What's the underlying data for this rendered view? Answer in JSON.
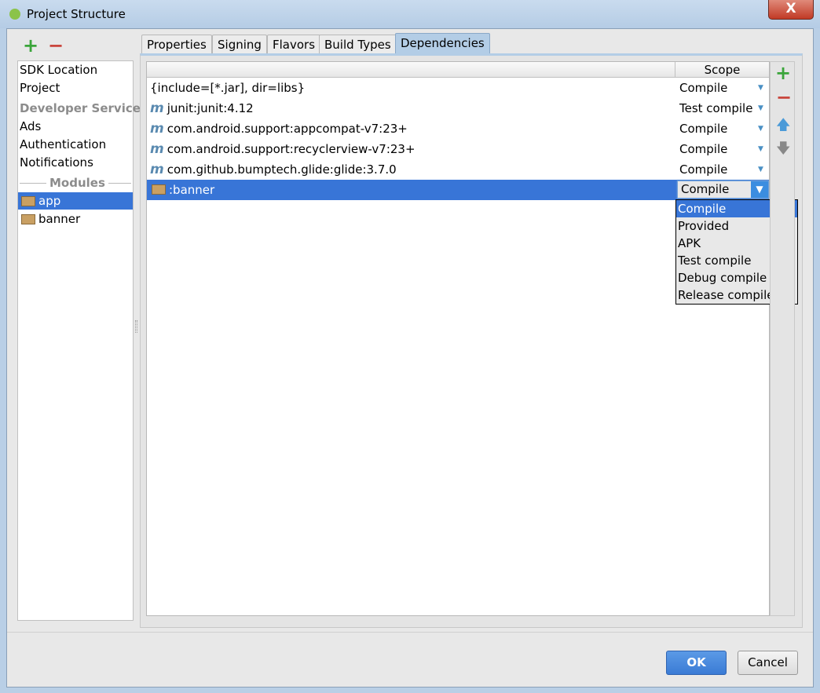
{
  "window": {
    "title": "Project Structure",
    "close": "X"
  },
  "left": {
    "add": "+",
    "remove": "−",
    "items": [
      "SDK Location",
      "Project"
    ],
    "dev_header": "Developer Services",
    "dev_items": [
      "Ads",
      "Authentication",
      "Notifications"
    ],
    "modules_header": "Modules",
    "modules": [
      "app",
      "banner"
    ]
  },
  "tabs": [
    "Properties",
    "Signing",
    "Flavors",
    "Build Types",
    "Dependencies"
  ],
  "table": {
    "scope_header": "Scope",
    "rows": [
      {
        "name": "{include=[*.jar], dir=libs}",
        "scope": "Compile",
        "icon": "none"
      },
      {
        "name": "junit:junit:4.12",
        "scope": "Test compile",
        "icon": "maven"
      },
      {
        "name": "com.android.support:appcompat-v7:23+",
        "scope": "Compile",
        "icon": "maven"
      },
      {
        "name": "com.android.support:recyclerview-v7:23+",
        "scope": "Compile",
        "icon": "maven"
      },
      {
        "name": "com.github.bumptech.glide:glide:3.7.0",
        "scope": "Compile",
        "icon": "maven"
      },
      {
        "name": ":banner",
        "scope": "Compile",
        "icon": "module"
      }
    ]
  },
  "scope_options": [
    "Compile",
    "Provided",
    "APK",
    "Test compile",
    "Debug compile",
    "Release compile"
  ],
  "buttons": {
    "ok": "OK",
    "cancel": "Cancel"
  },
  "colors": {
    "selection": "#3875d7",
    "add": "#3aa53a",
    "remove": "#c9463d"
  }
}
